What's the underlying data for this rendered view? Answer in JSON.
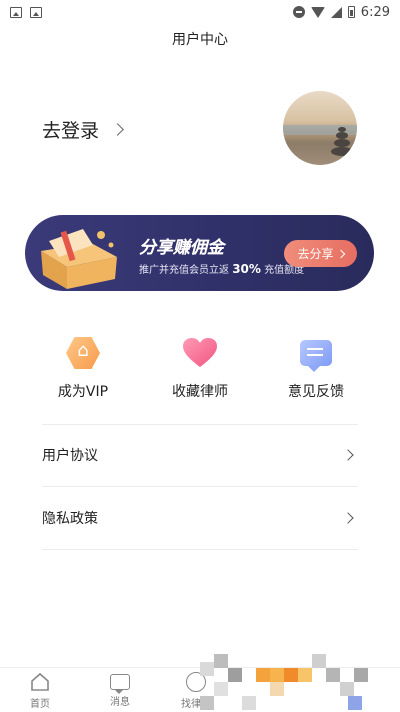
{
  "status_bar": {
    "time": "6:29"
  },
  "header": {
    "title": "用户中心"
  },
  "login": {
    "label": "去登录"
  },
  "banner": {
    "headline": "分享赚佣金",
    "subtitle_prefix": "推广并充值会员立返",
    "subtitle_highlight": "30%",
    "subtitle_suffix": "充值额度",
    "button_label": "去分享"
  },
  "actions": [
    {
      "label": "成为VIP",
      "icon": "vip-hexagon-icon"
    },
    {
      "label": "收藏律师",
      "icon": "heart-icon"
    },
    {
      "label": "意见反馈",
      "icon": "feedback-chat-icon"
    }
  ],
  "menu": [
    {
      "label": "用户协议"
    },
    {
      "label": "隐私政策"
    }
  ],
  "tabbar": {
    "items": [
      {
        "label": "首页"
      },
      {
        "label": "消息"
      },
      {
        "label": "找律师"
      }
    ]
  },
  "colors": {
    "banner_bg": "#2f3068",
    "share_button": "#e66e62",
    "vip_orange": "#f79a4a",
    "heart_pink": "#f46a8f",
    "feedback_blue": "#7f9cf4"
  }
}
